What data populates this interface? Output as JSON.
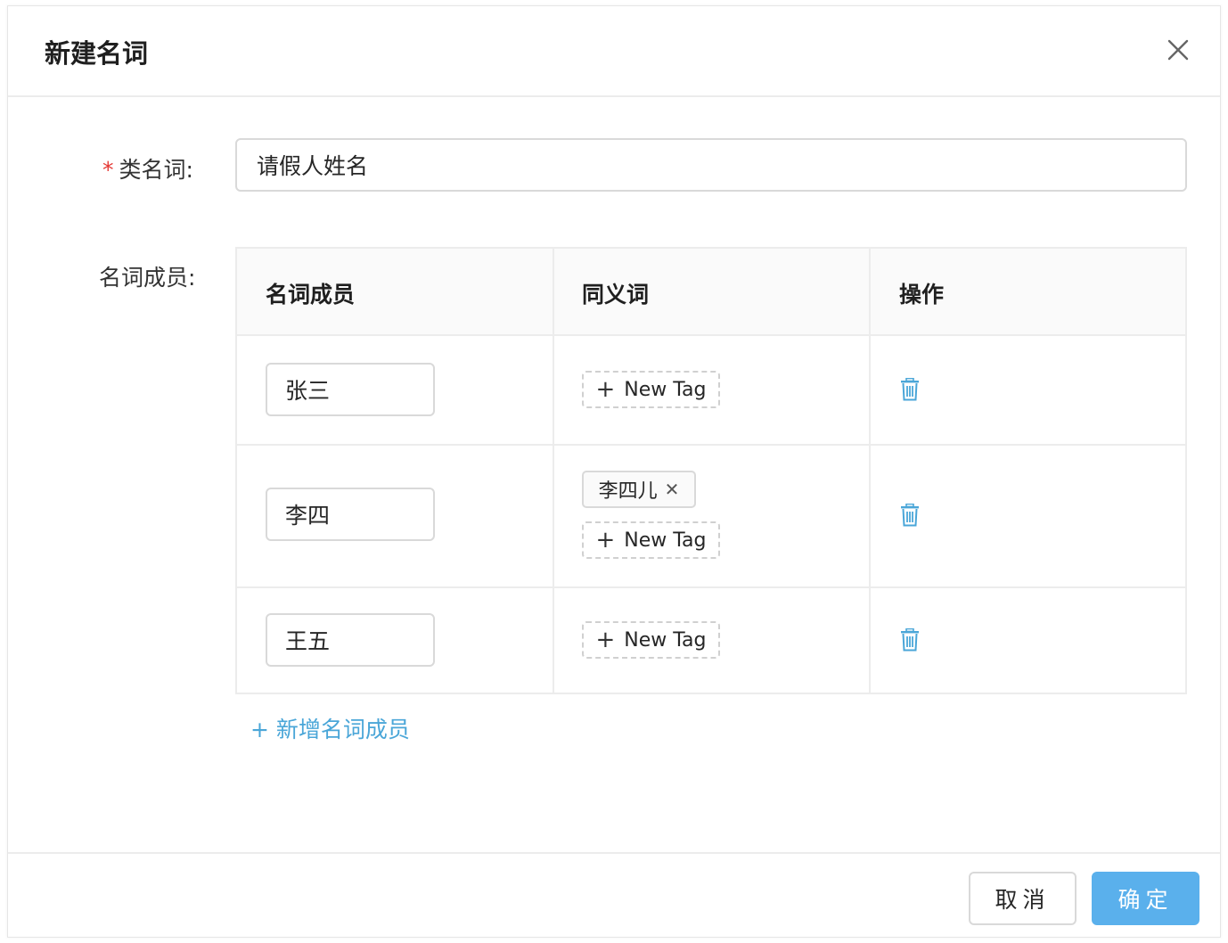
{
  "dialog": {
    "title": "新建名词",
    "close_icon": "close-icon"
  },
  "form": {
    "category_label": "类名词:",
    "required_mark": "*",
    "category_value": "请假人姓名",
    "members_label": "名词成员:"
  },
  "table": {
    "headers": [
      "名词成员",
      "同义词",
      "操作"
    ],
    "rows": [
      {
        "member": "张三",
        "synonyms": [],
        "new_tag_label": "New Tag"
      },
      {
        "member": "李四",
        "synonyms": [
          "李四儿"
        ],
        "new_tag_label": "New Tag"
      },
      {
        "member": "王五",
        "synonyms": [],
        "new_tag_label": "New Tag"
      }
    ],
    "delete_icon": "trash-icon",
    "accent_color": "#4aa6d8"
  },
  "add_member": {
    "plus": "+",
    "label": "新增名词成员"
  },
  "footer": {
    "cancel_label": "取消",
    "ok_label": "确定",
    "ok_color": "#5ab0ec"
  }
}
